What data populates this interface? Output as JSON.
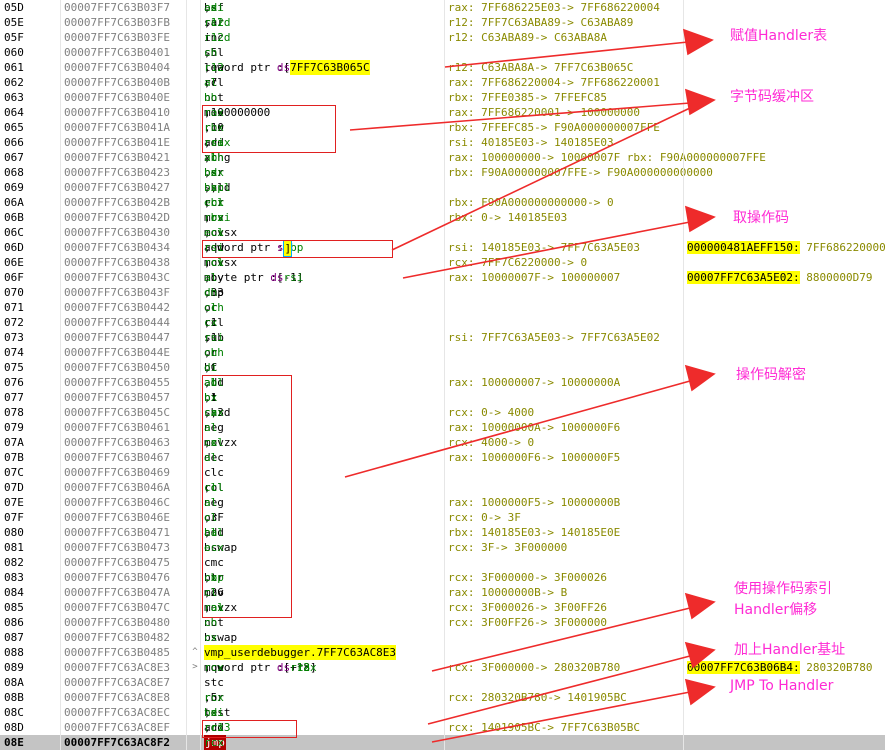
{
  "rows": [
    {
      "idx": "05D",
      "addr": "00007FF7C63B03F7",
      "dis": "bsf ax,di",
      "cmt": "rax: 7FF686225E03-> 7FF686220004"
    },
    {
      "idx": "05E",
      "addr": "00007FF7C63B03FB",
      "dis": "sar r12d,cl",
      "cmt": "r12: 7FF7C63ABA89-> C63ABA89"
    },
    {
      "idx": "05F",
      "addr": "00007FF7C63B03FE",
      "dis": "inc r12d",
      "cmt": "r12: C63ABA89-> C63ABA8A"
    },
    {
      "idx": "060",
      "addr": "00007FF7C63B0401",
      "dis": "shl ch,5",
      "cmt": ""
    },
    {
      "idx": "061",
      "addr": "00007FF7C63B0404",
      "dis": "lea r12,qword ptr ds:[7FF7C63B065C]",
      "cmt": "r12: C63ABA8A-> 7FF7C63B065C"
    },
    {
      "idx": "062",
      "addr": "00007FF7C63B040B",
      "dis": "rcl al,7",
      "cmt": "rax: 7FF686220004-> 7FF686220001"
    },
    {
      "idx": "063",
      "addr": "00007FF7C63B040E",
      "dis": "not bh",
      "cmt": "rbx: 7FFE0385-> 7FFEFC85"
    },
    {
      "idx": "064",
      "addr": "00007FF7C63B0410",
      "dis": "mov rax,100000000",
      "cmt": "rax: 7FF686220001-> 100000000"
    },
    {
      "idx": "065",
      "addr": "00007FF7C63B041A",
      "dis": "rcr rbx,10",
      "cmt": "rbx: 7FFEFC85-> F90A000000007FFE"
    },
    {
      "idx": "066",
      "addr": "00007FF7C63B041E",
      "dis": "add rsi,rax",
      "cmt": "rsi: 40185E03-> 140185E03"
    },
    {
      "idx": "067",
      "addr": "00007FF7C63B0421",
      "dis": "xchg al,bh",
      "cmt": "rax: 100000000-> 10000007F rbx: F90A000000007FFE"
    },
    {
      "idx": "068",
      "addr": "00007FF7C63B0423",
      "dis": "bsr bx,dx",
      "cmt": "rbx: F90A000000007FFE-> F90A000000000000"
    },
    {
      "idx": "069",
      "addr": "00007FF7C63B0427",
      "dis": "shld bx,sp,cl",
      "cmt": ""
    },
    {
      "idx": "06A",
      "addr": "00007FF7C63B042B",
      "dis": "rcr ebx,cl",
      "cmt": "rbx: F90A000000000000-> 0"
    },
    {
      "idx": "06B",
      "addr": "00007FF7C63B042D",
      "dis": "mov rbx,rsi",
      "cmt": "rbx: 0-> 140185E03"
    },
    {
      "idx": "06C",
      "addr": "00007FF7C63B0430",
      "dis": "movsx ecx,cl",
      "cmt": ""
    },
    {
      "idx": "06D",
      "addr": "00007FF7C63B0434",
      "dis": "add rsi,qword ptr ss:[rbp]",
      "cmt": "rsi: 140185E03-> 7FF7C63A5E03",
      "stk_addr": "000000481AEFF150:",
      "stk_val": "7FF686220000"
    },
    {
      "idx": "06E",
      "addr": "00007FF7C63B0438",
      "dis": "movsx rcx,cl",
      "cmt": "rcx: 7FF7C6220000-> 0"
    },
    {
      "idx": "06F",
      "addr": "00007FF7C63B043C",
      "dis": "mov al,byte ptr ds:[rsi-1]",
      "cmt": "rax: 10000007F-> 100000007",
      "stk_addr": "00007FF7C63A5E02:",
      "stk_val": "8800000D79"
    },
    {
      "idx": "070",
      "addr": "00007FF7C63B043F",
      "dis": "cmp dh,33",
      "cmt": ""
    },
    {
      "idx": "071",
      "addr": "00007FF7C63B0442",
      "dis": "or cl,ch",
      "cmt": ""
    },
    {
      "idx": "072",
      "addr": "00007FF7C63B0444",
      "dis": "rcl cx,1",
      "cmt": ""
    },
    {
      "idx": "073",
      "addr": "00007FF7C63B0447",
      "dis": "sub rsi,1",
      "cmt": "rsi: 7FF7C63A5E03-> 7FF7C63A5E02"
    },
    {
      "idx": "074",
      "addr": "00007FF7C63B044E",
      "dis": "or ch,ch",
      "cmt": ""
    },
    {
      "idx": "075",
      "addr": "00007FF7C63B0450",
      "dis": "bt di,C",
      "cmt": ""
    },
    {
      "idx": "076",
      "addr": "00007FF7C63B0455",
      "dis": "add al,bl",
      "cmt": "rax: 100000007-> 10000000A"
    },
    {
      "idx": "077",
      "addr": "00007FF7C63B0457",
      "dis": "bt bx,1",
      "cmt": ""
    },
    {
      "idx": "078",
      "addr": "00007FF7C63B045C",
      "dis": "shrd cx,ax,3",
      "cmt": "rcx: 0-> 4000"
    },
    {
      "idx": "079",
      "addr": "00007FF7C63B0461",
      "dis": "neg al",
      "cmt": "rax: 10000000A-> 1000000F6"
    },
    {
      "idx": "07A",
      "addr": "00007FF7C63B0463",
      "dis": "movzx cx,cl",
      "cmt": "rcx: 4000-> 0"
    },
    {
      "idx": "07B",
      "addr": "00007FF7C63B0467",
      "dis": "dec al",
      "cmt": "rax: 1000000F6-> 1000000F5"
    },
    {
      "idx": "07C",
      "addr": "00007FF7C63B0469",
      "dis": "clc",
      "cmt": ""
    },
    {
      "idx": "07D",
      "addr": "00007FF7C63B046A",
      "dis": "rol cl,cl",
      "cmt": ""
    },
    {
      "idx": "07E",
      "addr": "00007FF7C63B046C",
      "dis": "neg al",
      "cmt": "rax: 1000000F5-> 10000000B"
    },
    {
      "idx": "07F",
      "addr": "00007FF7C63B046E",
      "dis": "or cl,3F",
      "cmt": "rcx: 0-> 3F"
    },
    {
      "idx": "080",
      "addr": "00007FF7C63B0471",
      "dis": "add bl,al",
      "cmt": "rbx: 140185E03-> 140185E0E"
    },
    {
      "idx": "081",
      "addr": "00007FF7C63B0473",
      "dis": "bswap ecx",
      "cmt": "rcx: 3F-> 3F000000"
    },
    {
      "idx": "082",
      "addr": "00007FF7C63B0475",
      "dis": "cmc",
      "cmt": ""
    },
    {
      "idx": "083",
      "addr": "00007FF7C63B0476",
      "dis": "btr cx,bp",
      "cmt": "rcx: 3F000000-> 3F000026"
    },
    {
      "idx": "084",
      "addr": "00007FF7C63B047A",
      "dis": "mov cl,26",
      "cmt": "rax: 10000000B-> B"
    },
    {
      "idx": "085",
      "addr": "00007FF7C63B047C",
      "dis": "movzx rax,al",
      "cmt": "rcx: 3F000026-> 3F00FF26"
    },
    {
      "idx": "086",
      "addr": "00007FF7C63B0480",
      "dis": "not ch",
      "cmt": "rcx: 3F00FF26-> 3F000000"
    },
    {
      "idx": "087",
      "addr": "00007FF7C63B0482",
      "dis": "bswap cx",
      "cmt": ""
    },
    {
      "idx": "088",
      "addr": "00007FF7C63B0485",
      "dis": "jmp vmp_userdebugger.7FF7C63AC8E3",
      "cmt": ""
    },
    {
      "idx": "089",
      "addr": "00007FF7C63AC8E3",
      "dis": "mov rcx,qword ptr ds:[r12+rax*8]",
      "cmt": "rcx: 3F000000-> 280320B780",
      "stk_addr": "00007FF7C63B06B4:",
      "stk_val": "280320B780"
    },
    {
      "idx": "08A",
      "addr": "00007FF7C63AC8E7",
      "dis": "stc",
      "cmt": ""
    },
    {
      "idx": "08B",
      "addr": "00007FF7C63AC8E8",
      "dis": "ror rcx,5",
      "cmt": "rcx: 280320B780-> 1401905BC"
    },
    {
      "idx": "08C",
      "addr": "00007FF7C63AC8EC",
      "dis": "test bx,di",
      "cmt": ""
    },
    {
      "idx": "08D",
      "addr": "00007FF7C63AC8EF",
      "dis": "add rcx,r13",
      "cmt": "rcx: 1401905BC-> 7FF7C63B05BC"
    },
    {
      "idx": "08E",
      "addr": "00007FF7C63AC8F2",
      "dis": "jmp rcx",
      "cmt": ""
    }
  ],
  "annotations": {
    "a1": "赋值Handler表",
    "a2": "字节码缓冲区",
    "a3": "取操作码",
    "a4": "操作码解密",
    "a5a": "使用操作码索引",
    "a5b": "Handler偏移",
    "a6": "加上Handler基址",
    "a7": "JMP To Handler"
  },
  "colors": {
    "annotation": "#ff2ad4",
    "arrow": "#ee2b2b",
    "highlight": "#ffff00",
    "register": "#008000",
    "comment": "#8a8a00",
    "selected_row": "#c4c4c4"
  }
}
